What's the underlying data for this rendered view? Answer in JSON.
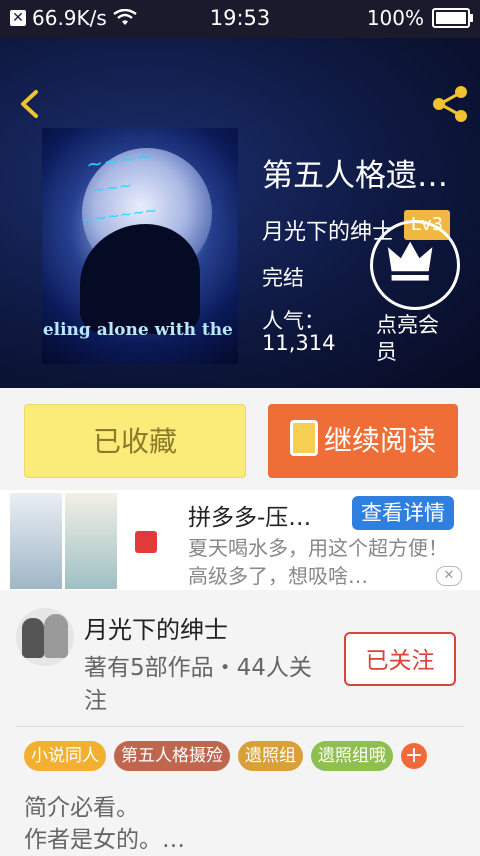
{
  "status_bar": {
    "speed": "66.9K/s",
    "time": "19:53",
    "battery": "100%"
  },
  "book": {
    "title": "第五人格遗…",
    "author": "月光下的绅士",
    "level": "Lv3",
    "status": "完结",
    "popularity_label": "人气：",
    "popularity_value": "11,314",
    "vip_label": "点亮会员",
    "cover_text": "eeling  alone with the st"
  },
  "actions": {
    "favorite": "已收藏",
    "continue_read": "继续阅读"
  },
  "ad": {
    "title": "拼多多-压…",
    "detail_button": "查看详情",
    "description": "夏天喝水多，用这个超方便！高级多了，想吸啥…"
  },
  "author_card": {
    "name": "月光下的绅士",
    "stats": "著有5部作品・44人关注",
    "follow_button": "已关注"
  },
  "tags": [
    {
      "label": "小说同人",
      "color": "#f3b030"
    },
    {
      "label": "第五人格摄殓",
      "color": "#c0664e"
    },
    {
      "label": "遗照组",
      "color": "#d9a03a"
    },
    {
      "label": "遗照组哦",
      "color": "#8fbf4f"
    }
  ],
  "tag_more": "+",
  "intro": "简介必看。\n作者是女的。…",
  "icons": {
    "back": "chevron-left-icon",
    "share": "share-icon",
    "vip": "crown-icon"
  }
}
